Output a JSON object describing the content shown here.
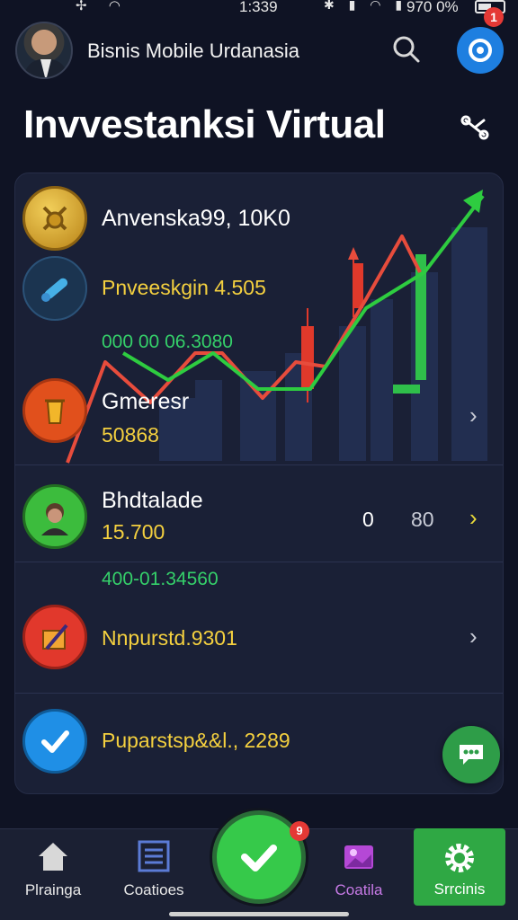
{
  "status_bar": {
    "time": "1:339",
    "battery": "970 0%"
  },
  "header": {
    "app_name": "Bisnis Mobile Urdanasia",
    "notification_count": "1"
  },
  "page": {
    "title": "Invvestanksi Virtual"
  },
  "chart": {
    "line_color_up": "#2ecc40",
    "line_color_down": "#e74c3c",
    "candle_red": "#e0392b",
    "candle_green": "#2fbf4a"
  },
  "items": [
    {
      "title": "Anvenska99, 10K0",
      "value": "",
      "icon": "gold-coin-icon",
      "color": "#d4a52a"
    },
    {
      "title": "",
      "value": "Pnveeskgin 4.505",
      "icon": "telescope-icon",
      "color": "#1f3b57"
    },
    {
      "title": "Gmeresr",
      "value": "50868",
      "icon": "trash-bin-icon",
      "color": "#e55a1f",
      "green_above": "000 00 06.3080"
    },
    {
      "title": "Bhdtalade",
      "value": "15.700",
      "icon": "person-avatar-icon",
      "color": "#3dbb3f",
      "stat_a": "0",
      "stat_b": "80"
    },
    {
      "title": "",
      "value": "Nnpurstd.9301",
      "icon": "box-pencil-icon",
      "color": "#e23b2e",
      "green_above": "400-01.34560"
    },
    {
      "title": "",
      "value": "Puparstsp&&l., 2289",
      "icon": "checkmark-icon",
      "color": "#1f8fe6"
    }
  ],
  "nav": [
    {
      "label": "Plrainga",
      "icon": "home-icon"
    },
    {
      "label": "Coatioes",
      "icon": "list-icon"
    },
    {
      "label": "",
      "icon": "check-icon",
      "badge": "9"
    },
    {
      "label": "Coatila",
      "icon": "gallery-icon"
    },
    {
      "label": "Srrcinis",
      "icon": "gear-icon"
    }
  ]
}
